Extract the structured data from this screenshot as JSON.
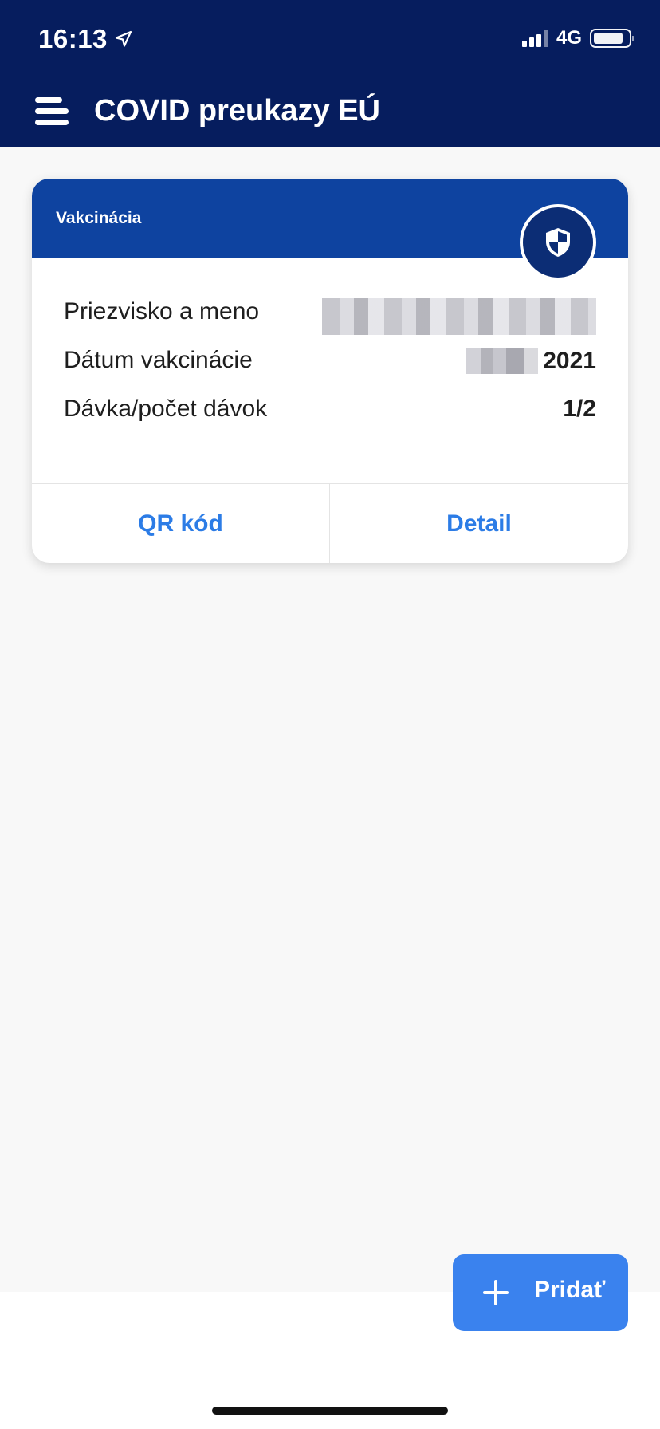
{
  "status_bar": {
    "time": "16:13",
    "network": "4G",
    "location_icon": "location-arrow-icon",
    "signal_icon": "cellular-signal-icon",
    "battery_icon": "battery-icon"
  },
  "header": {
    "title": "COVID preukazy EÚ",
    "menu_icon": "hamburger-menu-icon",
    "background_color": "#061d5e"
  },
  "certificate_card": {
    "type_label": "Vakcinácia",
    "badge_icon": "shield-icon",
    "header_color": "#0e43a0",
    "rows": [
      {
        "label": "Priezvisko a meno",
        "value": ""
      },
      {
        "label": "Dátum vakcinácie",
        "value": "2021"
      },
      {
        "label": "Dávka/počet dávok",
        "value": "1/2"
      }
    ],
    "actions": {
      "qr_label": "QR kód",
      "detail_label": "Detail"
    },
    "accent_color": "#2c7ce6"
  },
  "add_button": {
    "label": "Pridať",
    "icon": "plus-icon",
    "color": "#3a82ee"
  }
}
